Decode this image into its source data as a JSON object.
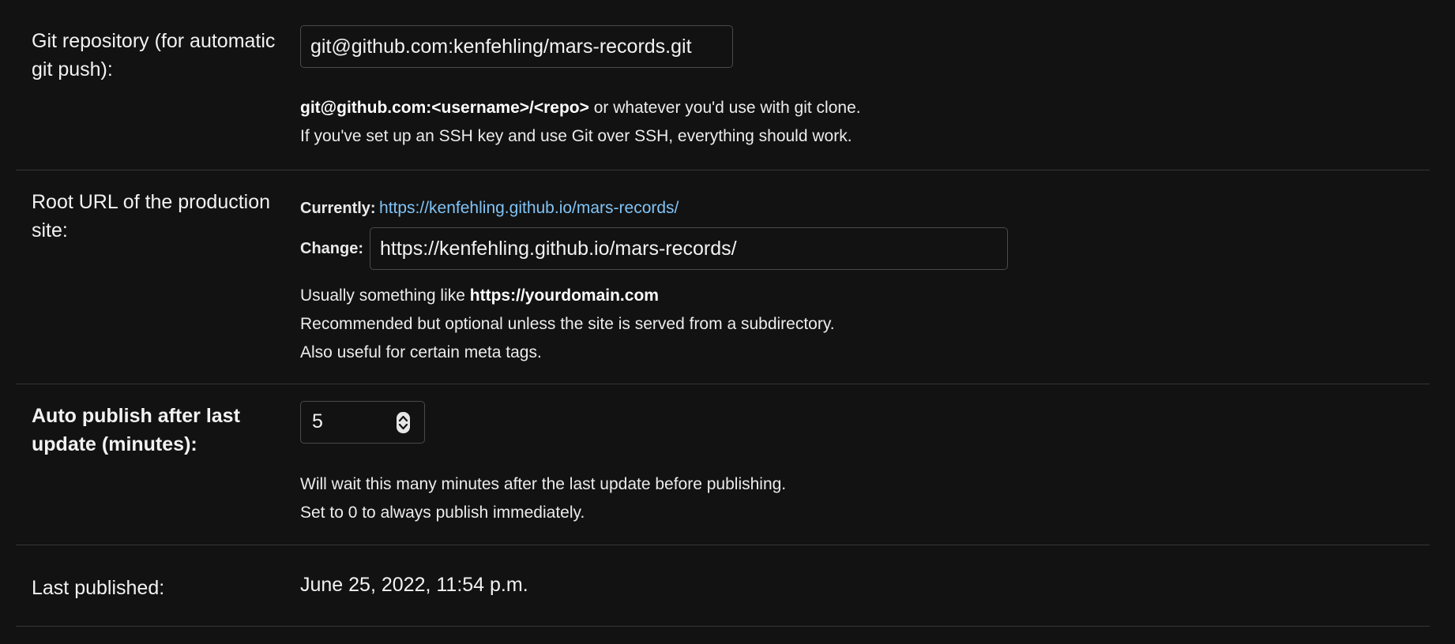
{
  "git_repository": {
    "label": "Git repository (for automatic git push):",
    "value": "git@github.com:kenfehling/mars-records.git",
    "help_bold": "git@github.com:<username>/<repo>",
    "help_rest": " or whatever you'd use with git clone.",
    "help_line2": "If you've set up an SSH key and use Git over SSH, everything should work."
  },
  "root_url": {
    "label": "Root URL of the production site:",
    "currently_label": "Currently:",
    "currently_link": "https://kenfehling.github.io/mars-records/",
    "change_label": "Change:",
    "value": "https://kenfehling.github.io/mars-records/",
    "help_prefix": "Usually something like ",
    "help_bold": "https://yourdomain.com",
    "help_line2": "Recommended but optional unless the site is served from a subdirectory.",
    "help_line3": "Also useful for certain meta tags."
  },
  "auto_publish": {
    "label": "Auto publish after last update (minutes):",
    "value": "5",
    "help_line1": "Will wait this many minutes after the last update before publishing.",
    "help_line2": "Set to 0 to always publish immediately."
  },
  "last_published": {
    "label": "Last published:",
    "value": "June 25, 2022, 11:54 p.m."
  },
  "colors": {
    "background": "#121212",
    "link": "#81c3f5",
    "divider": "#353535"
  }
}
